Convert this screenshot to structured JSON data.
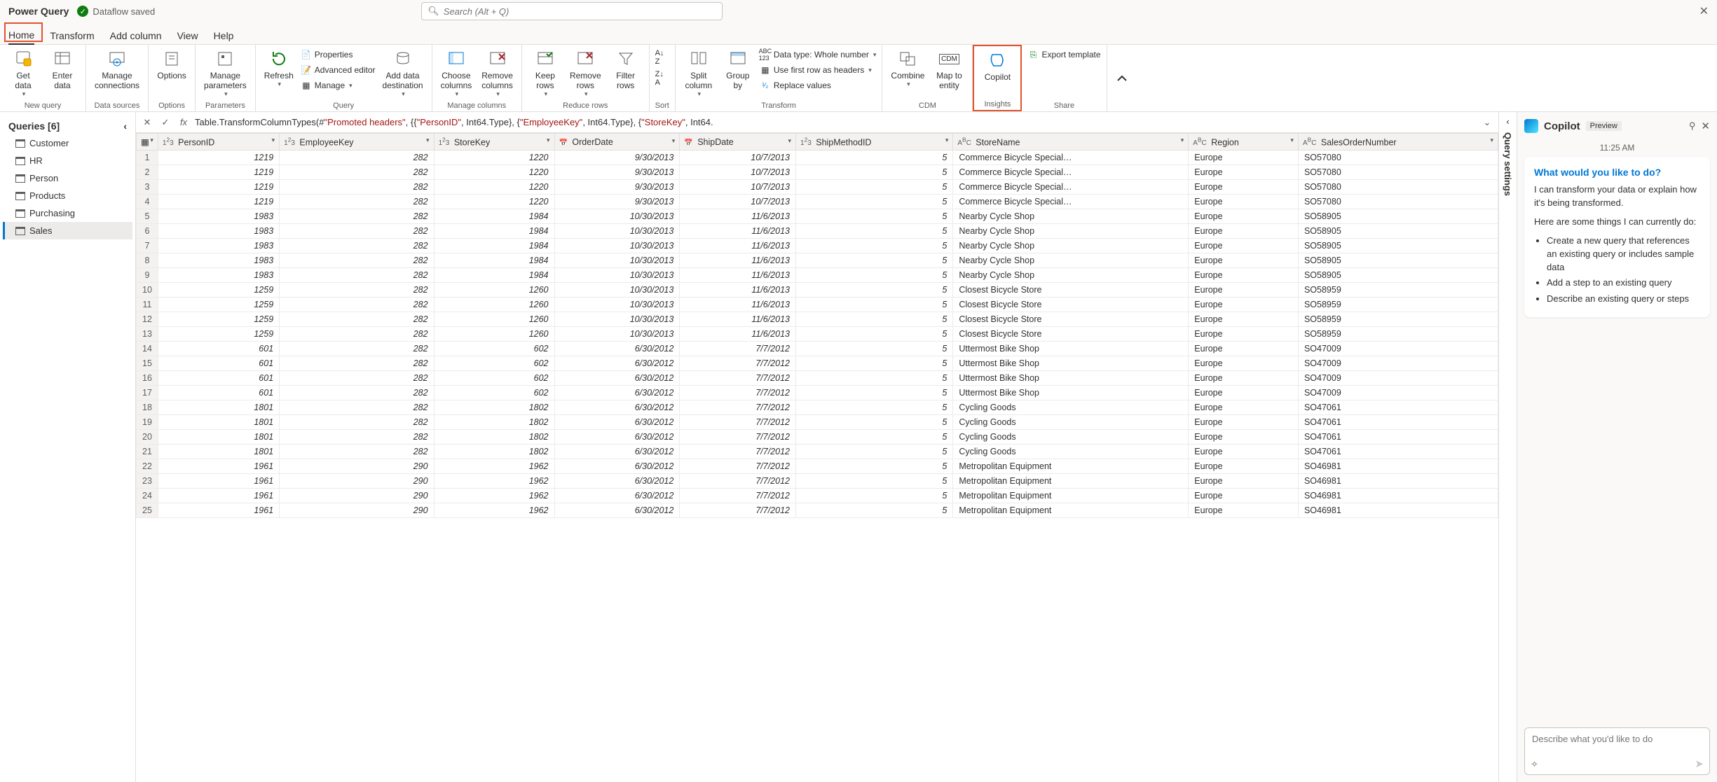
{
  "app": {
    "title": "Power Query",
    "status": "Dataflow saved"
  },
  "search": {
    "placeholder": "Search (Alt + Q)"
  },
  "tabs": [
    "Home",
    "Transform",
    "Add column",
    "View",
    "Help"
  ],
  "activeTab": "Home",
  "ribbon": {
    "groups": {
      "new_query": "New query",
      "data_sources": "Data sources",
      "options": "Options",
      "parameters": "Parameters",
      "query": "Query",
      "manage_cols": "Manage columns",
      "reduce_rows": "Reduce rows",
      "sort": "Sort",
      "transform": "Transform",
      "cdm": "CDM",
      "insights": "Insights",
      "share": "Share"
    },
    "buttons": {
      "get_data": "Get\ndata",
      "enter_data": "Enter\ndata",
      "manage_conn": "Manage\nconnections",
      "options": "Options",
      "manage_params": "Manage\nparameters",
      "refresh": "Refresh",
      "properties": "Properties",
      "adv_editor": "Advanced editor",
      "manage": "Manage",
      "add_data_dest": "Add data\ndestination",
      "choose_cols": "Choose\ncolumns",
      "remove_cols": "Remove\ncolumns",
      "keep_rows": "Keep\nrows",
      "remove_rows": "Remove\nrows",
      "filter_rows": "Filter\nrows",
      "split_col": "Split\ncolumn",
      "group_by": "Group\nby",
      "datatype": "Data type: Whole number",
      "first_row_hdr": "Use first row as headers",
      "replace_vals": "Replace values",
      "combine": "Combine",
      "map_entity": "Map to\nentity",
      "copilot": "Copilot",
      "export_tpl": "Export template"
    }
  },
  "queries": {
    "header": "Queries [6]",
    "items": [
      "Customer",
      "HR",
      "Person",
      "Products",
      "Purchasing",
      "Sales"
    ],
    "selected": "Sales"
  },
  "formula": {
    "prefix": "Table.TransformColumnTypes(#",
    "s1": "\"Promoted headers\"",
    "mid1": ", {{",
    "s2": "\"PersonID\"",
    "mid2": ", Int64.Type}, {",
    "s3": "\"EmployeeKey\"",
    "mid3": ", Int64.Type}, {",
    "s4": "\"StoreKey\"",
    "mid4": ", Int64."
  },
  "columns": [
    {
      "name": "PersonID",
      "type": "123"
    },
    {
      "name": "EmployeeKey",
      "type": "123"
    },
    {
      "name": "StoreKey",
      "type": "123"
    },
    {
      "name": "OrderDate",
      "type": "date"
    },
    {
      "name": "ShipDate",
      "type": "date"
    },
    {
      "name": "ShipMethodID",
      "type": "123"
    },
    {
      "name": "StoreName",
      "type": "abc"
    },
    {
      "name": "Region",
      "type": "abc"
    },
    {
      "name": "SalesOrderNumber",
      "type": "abc"
    }
  ],
  "rows": [
    [
      1219,
      282,
      1220,
      "9/30/2013",
      "10/7/2013",
      5,
      "Commerce Bicycle Special…",
      "Europe",
      "SO57080"
    ],
    [
      1219,
      282,
      1220,
      "9/30/2013",
      "10/7/2013",
      5,
      "Commerce Bicycle Special…",
      "Europe",
      "SO57080"
    ],
    [
      1219,
      282,
      1220,
      "9/30/2013",
      "10/7/2013",
      5,
      "Commerce Bicycle Special…",
      "Europe",
      "SO57080"
    ],
    [
      1219,
      282,
      1220,
      "9/30/2013",
      "10/7/2013",
      5,
      "Commerce Bicycle Special…",
      "Europe",
      "SO57080"
    ],
    [
      1983,
      282,
      1984,
      "10/30/2013",
      "11/6/2013",
      5,
      "Nearby Cycle Shop",
      "Europe",
      "SO58905"
    ],
    [
      1983,
      282,
      1984,
      "10/30/2013",
      "11/6/2013",
      5,
      "Nearby Cycle Shop",
      "Europe",
      "SO58905"
    ],
    [
      1983,
      282,
      1984,
      "10/30/2013",
      "11/6/2013",
      5,
      "Nearby Cycle Shop",
      "Europe",
      "SO58905"
    ],
    [
      1983,
      282,
      1984,
      "10/30/2013",
      "11/6/2013",
      5,
      "Nearby Cycle Shop",
      "Europe",
      "SO58905"
    ],
    [
      1983,
      282,
      1984,
      "10/30/2013",
      "11/6/2013",
      5,
      "Nearby Cycle Shop",
      "Europe",
      "SO58905"
    ],
    [
      1259,
      282,
      1260,
      "10/30/2013",
      "11/6/2013",
      5,
      "Closest Bicycle Store",
      "Europe",
      "SO58959"
    ],
    [
      1259,
      282,
      1260,
      "10/30/2013",
      "11/6/2013",
      5,
      "Closest Bicycle Store",
      "Europe",
      "SO58959"
    ],
    [
      1259,
      282,
      1260,
      "10/30/2013",
      "11/6/2013",
      5,
      "Closest Bicycle Store",
      "Europe",
      "SO58959"
    ],
    [
      1259,
      282,
      1260,
      "10/30/2013",
      "11/6/2013",
      5,
      "Closest Bicycle Store",
      "Europe",
      "SO58959"
    ],
    [
      601,
      282,
      602,
      "6/30/2012",
      "7/7/2012",
      5,
      "Uttermost Bike Shop",
      "Europe",
      "SO47009"
    ],
    [
      601,
      282,
      602,
      "6/30/2012",
      "7/7/2012",
      5,
      "Uttermost Bike Shop",
      "Europe",
      "SO47009"
    ],
    [
      601,
      282,
      602,
      "6/30/2012",
      "7/7/2012",
      5,
      "Uttermost Bike Shop",
      "Europe",
      "SO47009"
    ],
    [
      601,
      282,
      602,
      "6/30/2012",
      "7/7/2012",
      5,
      "Uttermost Bike Shop",
      "Europe",
      "SO47009"
    ],
    [
      1801,
      282,
      1802,
      "6/30/2012",
      "7/7/2012",
      5,
      "Cycling Goods",
      "Europe",
      "SO47061"
    ],
    [
      1801,
      282,
      1802,
      "6/30/2012",
      "7/7/2012",
      5,
      "Cycling Goods",
      "Europe",
      "SO47061"
    ],
    [
      1801,
      282,
      1802,
      "6/30/2012",
      "7/7/2012",
      5,
      "Cycling Goods",
      "Europe",
      "SO47061"
    ],
    [
      1801,
      282,
      1802,
      "6/30/2012",
      "7/7/2012",
      5,
      "Cycling Goods",
      "Europe",
      "SO47061"
    ],
    [
      1961,
      290,
      1962,
      "6/30/2012",
      "7/7/2012",
      5,
      "Metropolitan Equipment",
      "Europe",
      "SO46981"
    ],
    [
      1961,
      290,
      1962,
      "6/30/2012",
      "7/7/2012",
      5,
      "Metropolitan Equipment",
      "Europe",
      "SO46981"
    ],
    [
      1961,
      290,
      1962,
      "6/30/2012",
      "7/7/2012",
      5,
      "Metropolitan Equipment",
      "Europe",
      "SO46981"
    ],
    [
      1961,
      290,
      1962,
      "6/30/2012",
      "7/7/2012",
      5,
      "Metropolitan Equipment",
      "Europe",
      "SO46981"
    ]
  ],
  "querySettings": {
    "label": "Query settings"
  },
  "copilot": {
    "title": "Copilot",
    "badge": "Preview",
    "time": "11:25 AM",
    "heading": "What would you like to do?",
    "p1": "I can transform your data or explain how it's being transformed.",
    "p2": "Here are some things I can currently do:",
    "bullets": [
      "Create a new query that references an existing query or includes sample data",
      "Add a step to an existing query",
      "Describe an existing query or steps"
    ],
    "placeholder": "Describe what you'd like to do"
  }
}
